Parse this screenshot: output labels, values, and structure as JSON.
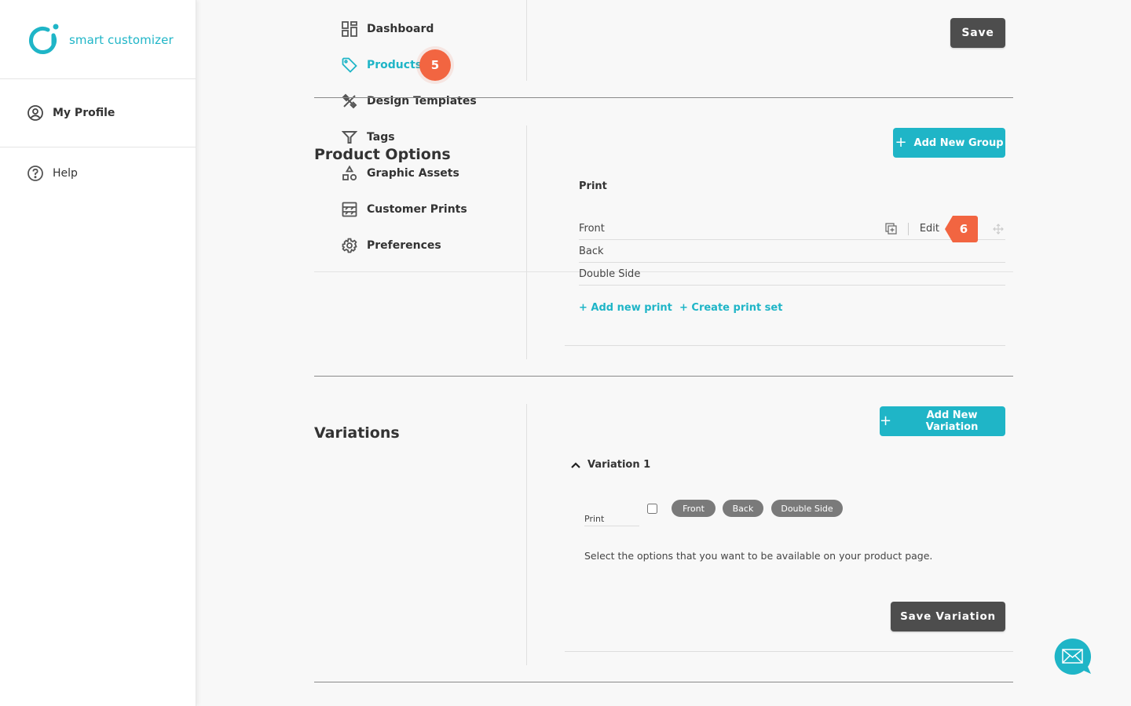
{
  "brand": {
    "name": "smart customizer",
    "color": "#1fb5c7"
  },
  "sidebar": {
    "profile": {
      "label": "My Profile",
      "icon": "user-circle-icon"
    },
    "items": [
      {
        "label": "Dashboard",
        "icon": "dashboard-icon",
        "active": false
      },
      {
        "label": "Products",
        "icon": "tag-icon",
        "active": true,
        "step": "5"
      },
      {
        "label": "Design Templates",
        "icon": "design-tools-icon",
        "active": false
      },
      {
        "label": "Tags",
        "icon": "filter-icon",
        "active": false
      },
      {
        "label": "Graphic Assets",
        "icon": "shapes-icon",
        "active": false
      },
      {
        "label": "Customer Prints",
        "icon": "prints-icon",
        "active": false
      },
      {
        "label": "Preferences",
        "icon": "gear-icon",
        "active": false
      }
    ],
    "help": {
      "label": "Help",
      "icon": "question-circle-icon"
    }
  },
  "top_section": {
    "save_label": "Save"
  },
  "product_options": {
    "title": "Product Options",
    "add_group_label": "Add New Group",
    "group": {
      "name": "Print",
      "prints": [
        "Front",
        "Back",
        "Double Side"
      ],
      "edit_label": "Edit",
      "step": "6"
    },
    "add_print_label": "+ Add new print",
    "create_set_label": "+ Create print set"
  },
  "variations": {
    "title": "Variations",
    "add_variation_label": "Add New Variation",
    "variation": {
      "name": "Variation 1",
      "option_label": "Print",
      "checked": false,
      "options": [
        "Front",
        "Back",
        "Double Side"
      ],
      "hint": "Select the options that you want to be available on your product page.",
      "save_label": "Save Variation"
    }
  },
  "colors": {
    "accent": "#1fb5c7",
    "step": "#f26541",
    "dark_button": "#4d4d4d",
    "pill": "#7a7a7a"
  }
}
